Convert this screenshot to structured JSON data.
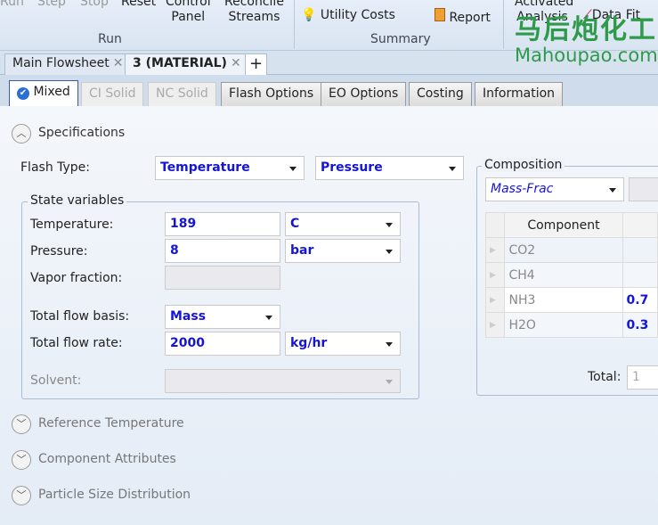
{
  "ribbon": {
    "run_buttons": [
      {
        "label": "Run",
        "disabled": true
      },
      {
        "label": "Step",
        "disabled": true
      },
      {
        "label": "Stop",
        "disabled": true
      },
      {
        "label": "Reset"
      },
      {
        "label": "Control\nPanel"
      },
      {
        "label": "Reconcile\nStreams"
      }
    ],
    "run_group": "Run",
    "utility_costs": "Utility Costs",
    "report": "Report",
    "summary_group": "Summary",
    "activated_analysis": "Activated Analysis",
    "data_fit": "Data Fit"
  },
  "watermark": {
    "chinese": "马后炮化工",
    "site": "Mahoupao.com"
  },
  "doc_tabs": [
    {
      "label": "Main Flowsheet"
    },
    {
      "label": "3 (MATERIAL)",
      "active": true
    }
  ],
  "sub_tabs": [
    "Mixed",
    "CI Solid",
    "NC Solid",
    "Flash Options",
    "EO Options",
    "Costing",
    "Information"
  ],
  "sections": {
    "specifications": "Specifications",
    "reference_temperature": "Reference Temperature",
    "component_attributes": "Component Attributes",
    "particle_size": "Particle Size Distribution"
  },
  "flash": {
    "label": "Flash Type:",
    "type1": "Temperature",
    "type2": "Pressure"
  },
  "state": {
    "title": "State variables",
    "temperature_label": "Temperature:",
    "temperature": "189",
    "temperature_unit": "C",
    "pressure_label": "Pressure:",
    "pressure": "8",
    "pressure_unit": "bar",
    "vapor_label": "Vapor fraction:",
    "basis_label": "Total flow basis:",
    "basis": "Mass",
    "rate_label": "Total flow rate:",
    "rate": "2000",
    "rate_unit": "kg/hr",
    "solvent_label": "Solvent:"
  },
  "composition": {
    "title": "Composition",
    "basis": "Mass-Frac",
    "column": "Component",
    "rows": [
      {
        "name": "CO2",
        "value": ""
      },
      {
        "name": "CH4",
        "value": ""
      },
      {
        "name": "NH3",
        "value": "0.7"
      },
      {
        "name": "H2O",
        "value": "0.3"
      }
    ],
    "total_label": "Total:",
    "total": "1"
  }
}
